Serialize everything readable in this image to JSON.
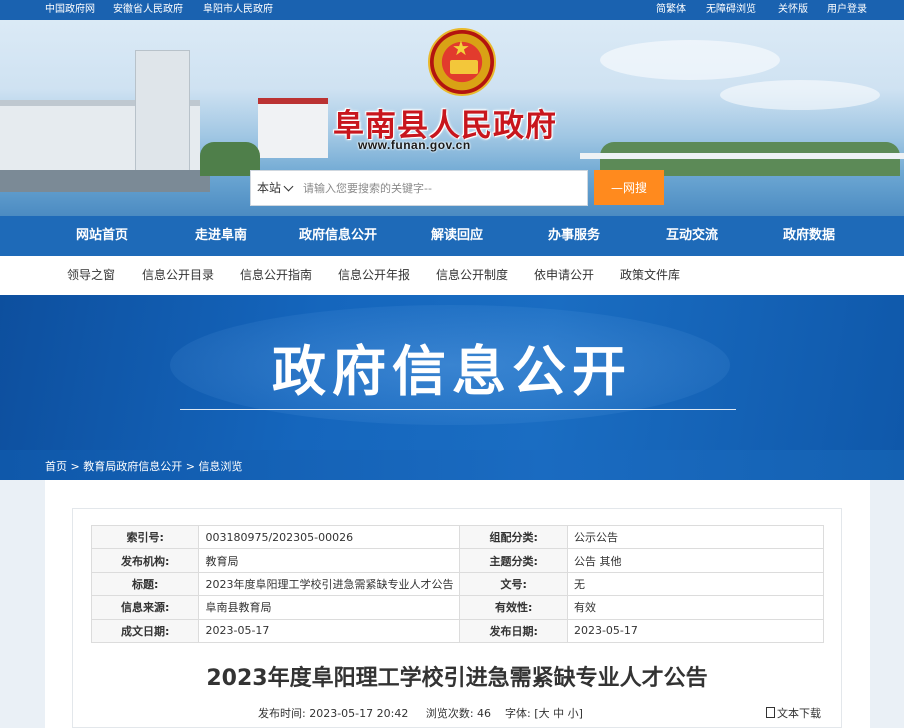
{
  "topbar": {
    "left_links": [
      "中国政府网",
      "安徽省人民政府",
      "阜阳市人民政府"
    ],
    "right_links": [
      "简繁体",
      "无障碍浏览",
      "关怀版",
      "用户登录"
    ]
  },
  "header": {
    "site_title": "阜南县人民政府",
    "site_url": "www.funan.gov.cn"
  },
  "search": {
    "scope": "本站",
    "placeholder": "请输入您要搜索的关键字--",
    "button_label": "—网搜"
  },
  "main_nav": [
    "网站首页",
    "走进阜南",
    "政府信息公开",
    "解读回应",
    "办事服务",
    "互动交流",
    "政府数据"
  ],
  "sub_nav": [
    "领导之窗",
    "信息公开目录",
    "信息公开指南",
    "信息公开年报",
    "信息公开制度",
    "依申请公开",
    "政策文件库"
  ],
  "hero": {
    "title": "政府信息公开"
  },
  "breadcrumb": {
    "items": [
      "首页",
      "教育局政府信息公开",
      "信息浏览"
    ],
    "separator": " > "
  },
  "meta": {
    "rows": [
      [
        {
          "k": "索引号:",
          "v": "003180975/202305-00026"
        },
        {
          "k": "组配分类:",
          "v": "公示公告"
        }
      ],
      [
        {
          "k": "发布机构:",
          "v": "教育局"
        },
        {
          "k": "主题分类:",
          "v": "公告 其他"
        }
      ],
      [
        {
          "k": "标题:",
          "v": "2023年度阜阳理工学校引进急需紧缺专业人才公告"
        },
        {
          "k": "文号:",
          "v": "无"
        }
      ],
      [
        {
          "k": "信息来源:",
          "v": "阜南县教育局"
        },
        {
          "k": "有效性:",
          "v": "有效"
        }
      ],
      [
        {
          "k": "成文日期:",
          "v": "2023-05-17"
        },
        {
          "k": "发布日期:",
          "v": "2023-05-17"
        }
      ]
    ]
  },
  "article": {
    "title": "2023年度阜阳理工学校引进急需紧缺专业人才公告",
    "publish_label": "发布时间:",
    "publish_time": "2023-05-17 20:42",
    "views_label": "浏览次数:",
    "views": "46",
    "font_label": "字体:",
    "font_open": "[",
    "font_sizes": [
      "大",
      "中",
      "小"
    ],
    "font_close": "]",
    "download_label": "文本下载"
  },
  "colors": {
    "nav_blue": "#1e6ab8",
    "title_red": "#c8161d",
    "search_orange": "#ff8a1e"
  },
  "icons": [
    "chevron-down-icon",
    "national-emblem-icon",
    "document-download-icon"
  ]
}
